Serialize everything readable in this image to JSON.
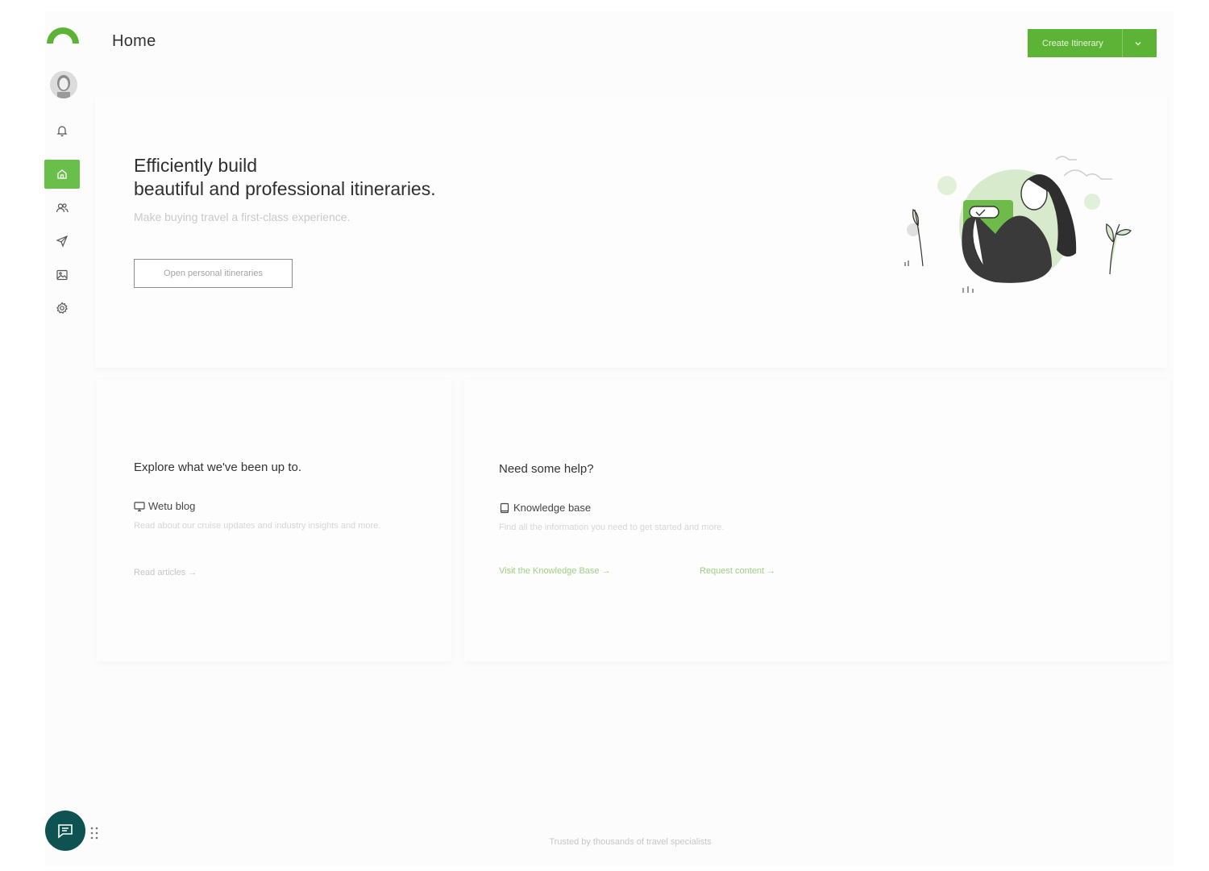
{
  "header": {
    "title": "Home",
    "create_button_label": "Create Itinerary"
  },
  "sidebar": {
    "items": [
      {
        "name": "notifications",
        "icon": "bell-icon"
      },
      {
        "name": "home",
        "icon": "home-icon",
        "active": true
      },
      {
        "name": "contacts",
        "icon": "users-icon"
      },
      {
        "name": "itineraries",
        "icon": "send-icon"
      },
      {
        "name": "media",
        "icon": "image-icon"
      },
      {
        "name": "settings",
        "icon": "gear-icon"
      }
    ]
  },
  "hero": {
    "title_line1": "Efficiently build",
    "title_line2": "beautiful and professional itineraries.",
    "subtitle": "Make buying travel a first-class experience.",
    "button_label": "Open personal itineraries"
  },
  "cards": {
    "left": {
      "heading": "Explore what we've been up to.",
      "link_title": "Wetu blog",
      "description": "Read about our cruise updates and industry insights and more.",
      "action": "Read articles →"
    },
    "right": {
      "heading": "Need some help?",
      "link_title": "Knowledge base",
      "description": "Find all the information you need to get started and more.",
      "action_primary": "Visit the Knowledge Base →",
      "action_secondary": "Request content →"
    }
  },
  "footer": {
    "text": "Trusted by thousands of travel specialists"
  },
  "colors": {
    "brand_green": "#5cb335",
    "chat_button": "#0e5352"
  }
}
